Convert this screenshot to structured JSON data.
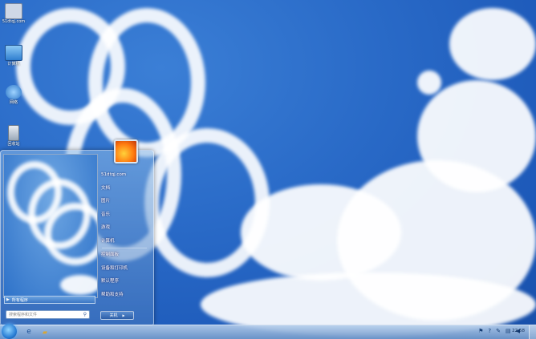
{
  "desktop_icons": [
    {
      "label": "51dtqj.com",
      "icon": "printer-icon",
      "color": "#cfd8e6"
    },
    {
      "label": "计算机",
      "icon": "computer-icon",
      "color": "#5aa6e6"
    },
    {
      "label": "网络",
      "icon": "network-icon",
      "color": "#3f8fd8"
    },
    {
      "label": "回收站",
      "icon": "recycle-bin-icon",
      "color": "#cdd6e2"
    }
  ],
  "start_menu": {
    "all_programs_label": "所有程序",
    "search_placeholder": "搜索程序和文件",
    "right_items": [
      "51dtqj.com",
      "文档",
      "图片",
      "音乐",
      "游戏",
      "计算机",
      "控制面板",
      "设备和打印机",
      "默认程序",
      "帮助和支持"
    ],
    "shutdown_label": "关机"
  },
  "taskbar": {
    "pinned": [
      {
        "icon": "internet-explorer-icon",
        "glyph": "e"
      },
      {
        "icon": "folder-icon",
        "glyph": "▰"
      }
    ],
    "tray_icons": [
      "flag-icon",
      "help-icon",
      "wrench-icon",
      "network-tray-icon",
      "volume-icon"
    ],
    "clock": "22:58"
  }
}
